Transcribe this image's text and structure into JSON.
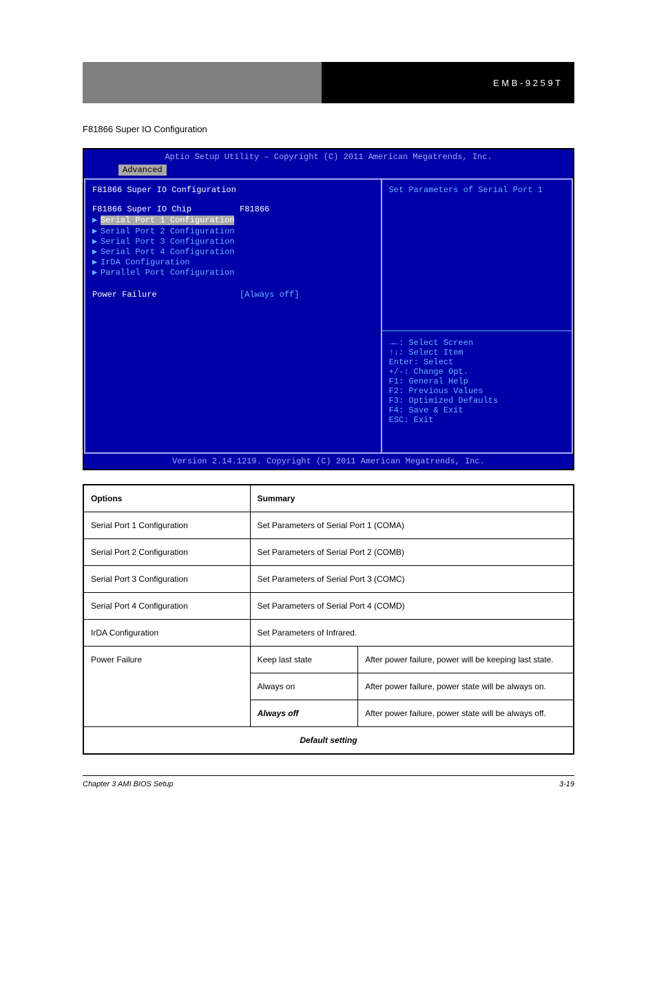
{
  "header": {
    "right_text": "E M B - 9 2 5 9 T"
  },
  "section_title": "F81866 Super IO Configuration",
  "bios": {
    "title": "Aptio Setup Utility – Copyright (C) 2011 American Megatrends, Inc.",
    "tab_active": "Advanced",
    "heading": "F81866 Super IO Configuration",
    "chip_label": "F81866 Super IO Chip",
    "chip_value": "F81866",
    "submenus": [
      "Serial Port 1 Configuration",
      "Serial Port 2 Configuration",
      "Serial Port 3 Configuration",
      "Serial Port 4 Configuration",
      "IrDA Configuration",
      "Parallel Port Configuration"
    ],
    "power_label": "Power Failure",
    "power_value": "[Always off]",
    "help_text": "Set Parameters of Serial Port 1",
    "keys": [
      "→←: Select Screen",
      "↑↓: Select Item",
      "Enter: Select",
      "+/-: Change Opt.",
      "F1: General Help",
      "F2: Previous Values",
      "F3: Optimized Defaults",
      "F4: Save & Exit",
      "ESC: Exit"
    ],
    "footer": "Version 2.14.1219. Copyright (C) 2011 American Megatrends, Inc."
  },
  "table": {
    "header": {
      "c1": "Options",
      "c2": "Summary"
    },
    "rows": [
      {
        "c1": "Serial Port 1 Configuration",
        "c2": "Set Parameters of Serial Port 1 (COMA)"
      },
      {
        "c1": "Serial Port 2 Configuration",
        "c2": "Set Parameters of Serial Port 2 (COMB)"
      },
      {
        "c1": "Serial Port 3 Configuration",
        "c2": "Set Parameters of Serial Port 3 (COMC)"
      },
      {
        "c1": "Serial Port 4 Configuration",
        "c2": "Set Parameters of Serial Port 4 (COMD)"
      },
      {
        "c1": "IrDA Configuration",
        "c2": "Set Parameters of Infrared."
      }
    ],
    "power_option_label": "Power Failure",
    "power_rows": [
      {
        "val": "Keep last state",
        "desc": "After power failure, power will be keeping last state."
      },
      {
        "val": "Always on",
        "desc": "After power failure, power state will be always on."
      },
      {
        "val": "Always off",
        "desc": "After power failure, power state will be always off.",
        "default": true
      }
    ],
    "default_legend": "Default setting"
  },
  "footer": {
    "left": "Chapter 3 AMI BIOS Setup",
    "right": "3-19"
  }
}
